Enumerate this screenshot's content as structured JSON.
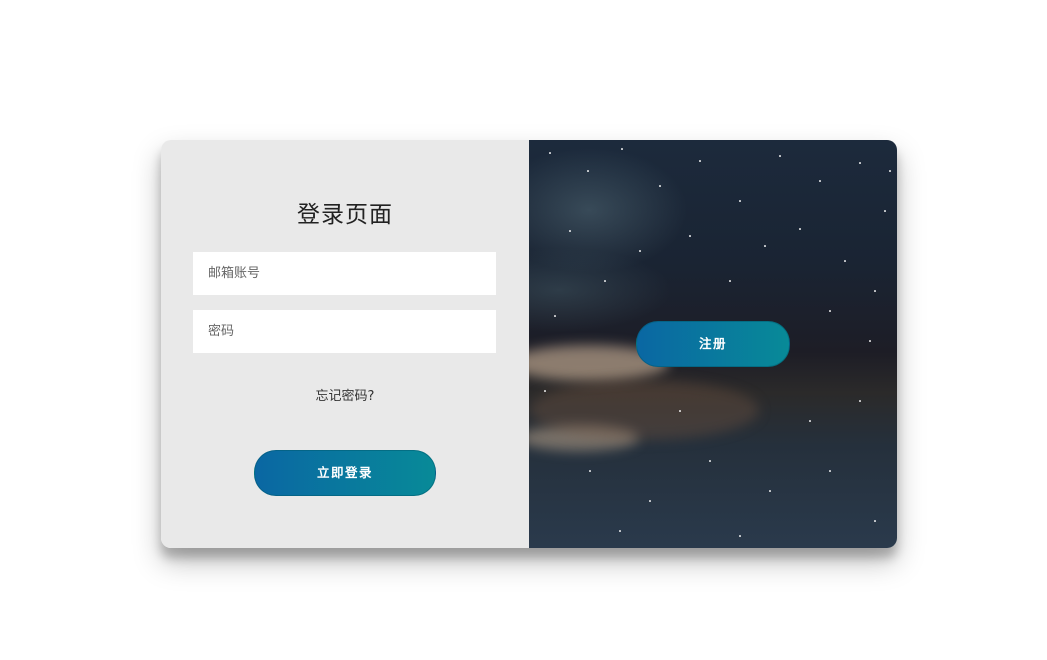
{
  "login": {
    "title": "登录页面",
    "email_placeholder": "邮箱账号",
    "password_placeholder": "密码",
    "forgot_link": "忘记密码?",
    "submit_label": "立即登录"
  },
  "overlay": {
    "register_label": "注册"
  },
  "colors": {
    "panel_bg": "#e9e9e9",
    "button_gradient_start": "#0a67a3",
    "button_gradient_end": "#088a98"
  }
}
